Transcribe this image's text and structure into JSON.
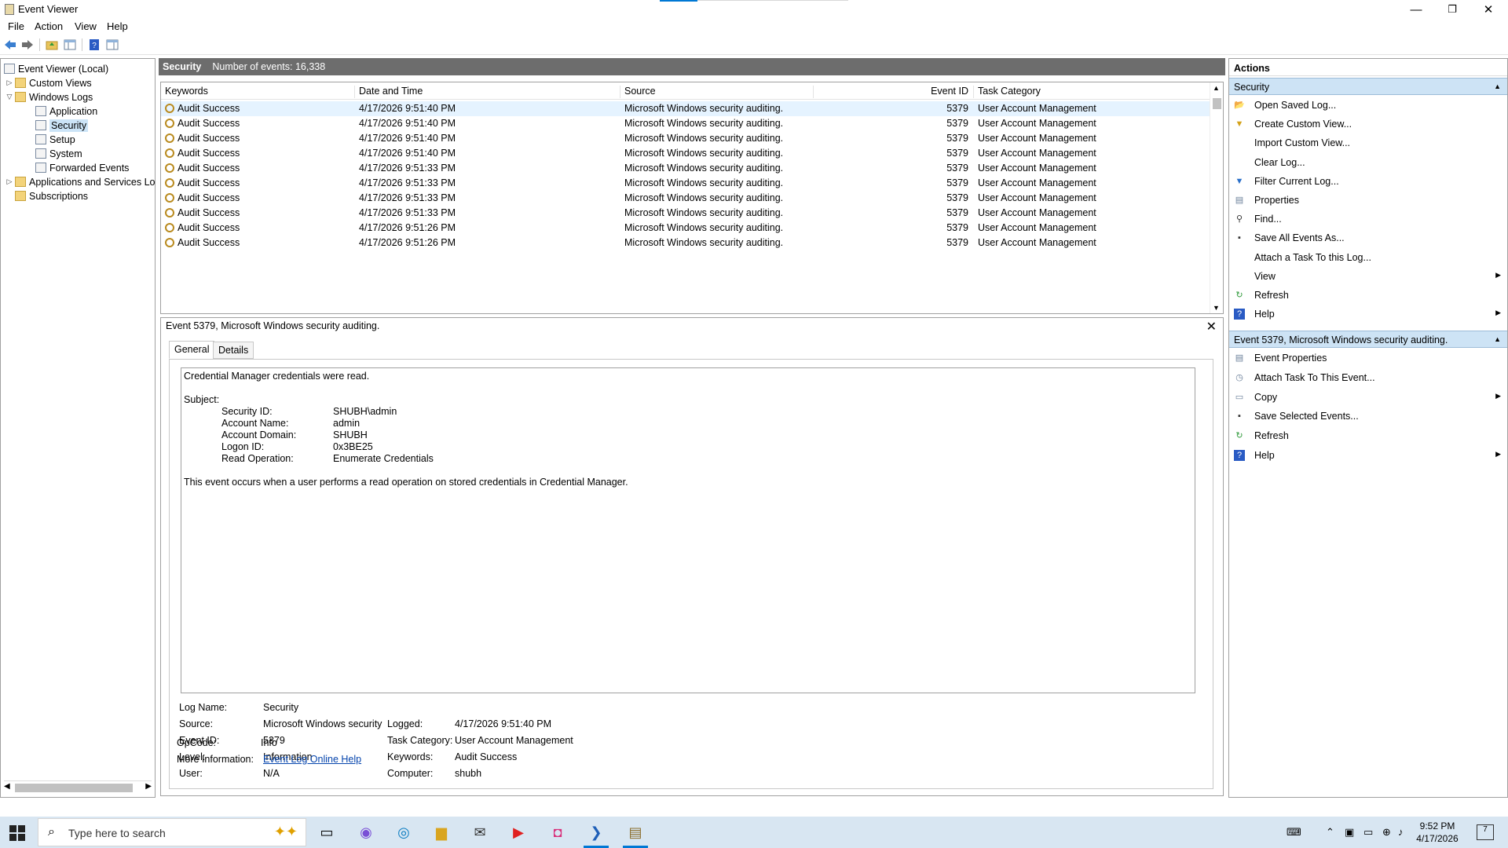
{
  "window": {
    "title": "Event Viewer",
    "minimize_glyph": "—",
    "restore_glyph": "❐",
    "close_glyph": "✕"
  },
  "menu": {
    "file": "File",
    "action": "Action",
    "view": "View",
    "help": "Help"
  },
  "toolbar": {
    "icons": [
      "back-arrow-icon",
      "forward-arrow-icon",
      "up-folder-icon",
      "show-hide-tree-icon",
      "help-icon",
      "action-pane-icon"
    ]
  },
  "tree": {
    "root": "Event Viewer (Local)",
    "custom_views": "Custom Views",
    "windows_logs": "Windows Logs",
    "application": "Application",
    "security": "Security",
    "setup": "Setup",
    "system": "System",
    "forwarded": "Forwarded Events",
    "apps_services": "Applications and Services Lo",
    "subscriptions": "Subscriptions"
  },
  "log": {
    "name": "Security",
    "count_label": "Number of events: 16,338"
  },
  "columns": {
    "keywords": "Keywords",
    "datetime": "Date and Time",
    "source": "Source",
    "eventid": "Event ID",
    "category": "Task Category"
  },
  "rows": [
    {
      "kw": "Audit Success",
      "dt": "4/17/2026 9:51:40 PM",
      "src": "Microsoft Windows security auditing.",
      "id": "5379",
      "cat": "User Account Management"
    },
    {
      "kw": "Audit Success",
      "dt": "4/17/2026 9:51:40 PM",
      "src": "Microsoft Windows security auditing.",
      "id": "5379",
      "cat": "User Account Management"
    },
    {
      "kw": "Audit Success",
      "dt": "4/17/2026 9:51:40 PM",
      "src": "Microsoft Windows security auditing.",
      "id": "5379",
      "cat": "User Account Management"
    },
    {
      "kw": "Audit Success",
      "dt": "4/17/2026 9:51:40 PM",
      "src": "Microsoft Windows security auditing.",
      "id": "5379",
      "cat": "User Account Management"
    },
    {
      "kw": "Audit Success",
      "dt": "4/17/2026 9:51:33 PM",
      "src": "Microsoft Windows security auditing.",
      "id": "5379",
      "cat": "User Account Management"
    },
    {
      "kw": "Audit Success",
      "dt": "4/17/2026 9:51:33 PM",
      "src": "Microsoft Windows security auditing.",
      "id": "5379",
      "cat": "User Account Management"
    },
    {
      "kw": "Audit Success",
      "dt": "4/17/2026 9:51:33 PM",
      "src": "Microsoft Windows security auditing.",
      "id": "5379",
      "cat": "User Account Management"
    },
    {
      "kw": "Audit Success",
      "dt": "4/17/2026 9:51:33 PM",
      "src": "Microsoft Windows security auditing.",
      "id": "5379",
      "cat": "User Account Management"
    },
    {
      "kw": "Audit Success",
      "dt": "4/17/2026 9:51:26 PM",
      "src": "Microsoft Windows security auditing.",
      "id": "5379",
      "cat": "User Account Management"
    },
    {
      "kw": "Audit Success",
      "dt": "4/17/2026 9:51:26 PM",
      "src": "Microsoft Windows security auditing.",
      "id": "5379",
      "cat": "User Account Management"
    }
  ],
  "detail": {
    "title": "Event 5379, Microsoft Windows security auditing.",
    "tab_general": "General",
    "tab_details": "Details",
    "msg_line1": "Credential Manager credentials were read.",
    "subject": "Subject:",
    "fields": [
      {
        "k": "Security ID:",
        "v": "SHUBH\\admin"
      },
      {
        "k": "Account Name:",
        "v": "admin"
      },
      {
        "k": "Account Domain:",
        "v": "SHUBH"
      },
      {
        "k": "Logon ID:",
        "v": "0x3BE25"
      },
      {
        "k": "Read Operation:",
        "v": "Enumerate Credentials"
      }
    ],
    "msg_footer": "This event occurs when a user performs a read operation on stored credentials in Credential Manager.",
    "log_name_k": "Log Name:",
    "log_name_v": "Security",
    "source_k": "Source:",
    "source_v": "Microsoft Windows security",
    "logged_k": "Logged:",
    "logged_v": "4/17/2026 9:51:40 PM",
    "eventid_k": "Event ID:",
    "eventid_v": "5379",
    "taskcat_k": "Task Category:",
    "taskcat_v": "User Account Management",
    "level_k": "Level:",
    "level_v": "Information",
    "keywords_k": "Keywords:",
    "keywords_v": "Audit Success",
    "user_k": "User:",
    "user_v": "N/A",
    "computer_k": "Computer:",
    "computer_v": "shubh",
    "opcode_k": "OpCode:",
    "opcode_v": "Info",
    "moreinfo_k": "More Information:",
    "moreinfo_v": "Event Log Online Help"
  },
  "actions": {
    "header": "Actions",
    "section1": "Security",
    "items1": [
      "Open Saved Log...",
      "Create Custom View...",
      "Import Custom View...",
      "Clear Log...",
      "Filter Current Log...",
      "Properties",
      "Find...",
      "Save All Events As...",
      "Attach a Task To this Log...",
      "View",
      "Refresh",
      "Help"
    ],
    "section2": "Event 5379, Microsoft Windows security auditing.",
    "items2": [
      "Event Properties",
      "Attach Task To This Event...",
      "Copy",
      "Save Selected Events...",
      "Refresh",
      "Help"
    ]
  },
  "taskbar": {
    "search_placeholder": "Type here to search",
    "time": "9:52 PM",
    "date": "4/17/2026",
    "notif_count": "7"
  },
  "colors": {
    "accent": "#0078d4",
    "section_bg": "#cde3f5",
    "header_bg": "#6d6d6d"
  }
}
